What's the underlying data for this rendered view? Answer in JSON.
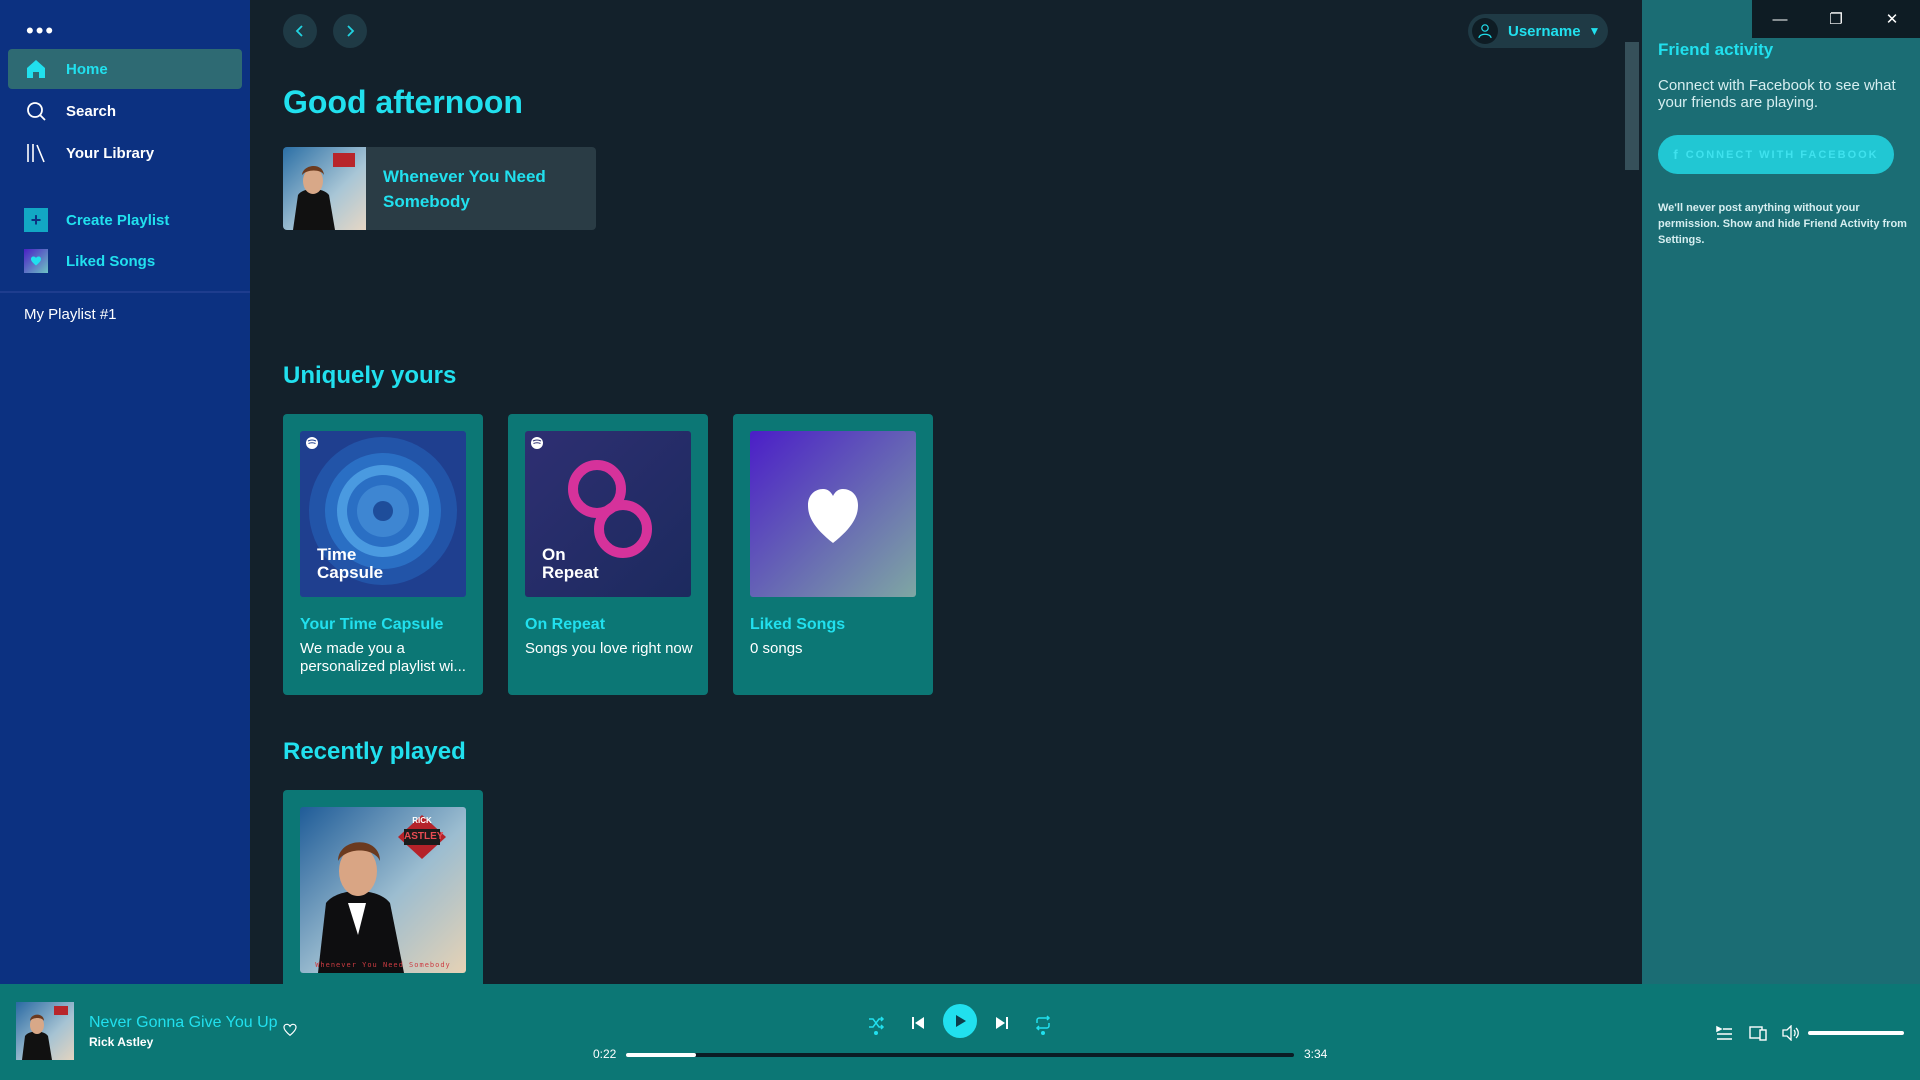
{
  "sidebar": {
    "menu_icon": "more-dots-icon",
    "items": [
      {
        "label": "Home",
        "icon": "home-icon"
      },
      {
        "label": "Search",
        "icon": "search-icon"
      },
      {
        "label": "Your Library",
        "icon": "library-icon"
      }
    ],
    "actions": [
      {
        "label": "Create Playlist",
        "icon": "plus-icon"
      },
      {
        "label": "Liked Songs",
        "icon": "heart-icon"
      }
    ],
    "playlists": [
      "My Playlist #1"
    ]
  },
  "header": {
    "username": "Username"
  },
  "main": {
    "greeting": "Good afternoon",
    "shortcut": {
      "label": "Whenever You Need Somebody"
    },
    "section_uniquely": "Uniquely yours",
    "cards": [
      {
        "title": "Your Time Capsule",
        "desc": "We made you a personalized playlist wi...",
        "art_label": "Time Capsule"
      },
      {
        "title": "On Repeat",
        "desc": "Songs you love right now",
        "art_label": "On Repeat"
      },
      {
        "title": "Liked Songs",
        "desc": "0 songs",
        "art_label": ""
      }
    ],
    "section_recent": "Recently played",
    "recent_album_text": {
      "band": "RICK",
      "name": "ASTLEY",
      "caption": "Whenever You Need Somebody"
    }
  },
  "friend_activity": {
    "title": "Friend activity",
    "text": "Connect with Facebook to see what your friends are playing.",
    "button": "CONNECT WITH FACEBOOK",
    "note": "We'll never post anything without your permission. Show and hide Friend Activity from Settings."
  },
  "player": {
    "track": "Never Gonna Give You Up",
    "artist": "Rick Astley",
    "elapsed": "0:22",
    "duration": "3:34",
    "progress": 0.105,
    "volume": 1.0
  },
  "colors": {
    "accent": "#21e0ee",
    "sidebar": "#0c3181",
    "card": "#0c7775",
    "main_bg": "#13212b",
    "friend_bg": "#1b6d74"
  }
}
